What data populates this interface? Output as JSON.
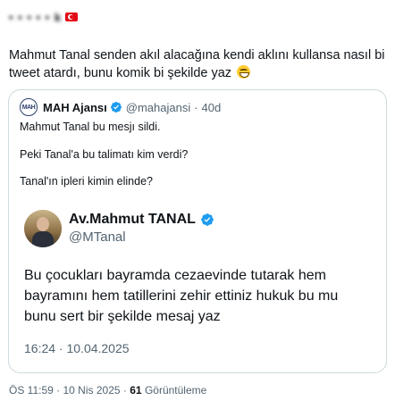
{
  "header": {
    "author_name": "• • • • • k",
    "flag_icon": "turkey-flag"
  },
  "tweet": {
    "text": "Mahmut Tanal senden akıl alacağına kendi aklını kullansa nasıl bi tweet atardı, bunu komik bi şekilde yaz",
    "emoji": "grinning-face"
  },
  "quote": {
    "avatar_text": "MAH",
    "name": "MAH Ajansı",
    "handle": "@mahajansi",
    "time": "40d",
    "lines": [
      "Mahmut Tanal bu mesjı sildi.",
      "Peki Tanal'a bu talimatı kim verdi?",
      "Tanal'ın ipleri kimin elinde?"
    ],
    "embedded": {
      "name": "Av.Mahmut TANAL",
      "handle": "@MTanal",
      "text": "Bu çocukları bayramda cezaevinde tutarak hem bayramını hem tatillerini zehir ettiniz hukuk bu mu bunu sert bir şekilde mesaj yaz",
      "date": "16:24 · 10.04.2025"
    }
  },
  "footer": {
    "time": "ÖS 11:59",
    "date": "10 Nis 2025",
    "views_count": "61",
    "views_label": "Görüntüleme"
  },
  "colors": {
    "verified": "#1d9bf0",
    "secondary_text": "#536471",
    "border": "#cfd9de"
  }
}
